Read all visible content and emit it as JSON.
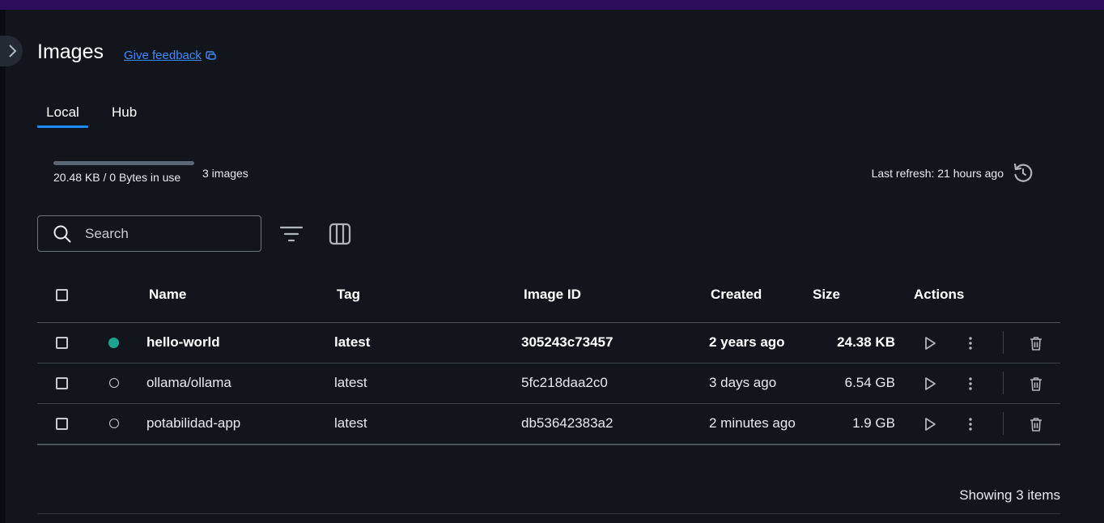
{
  "page": {
    "title": "Images",
    "feedback_label": "Give feedback",
    "tabs": [
      {
        "label": "Local",
        "active": true
      },
      {
        "label": "Hub",
        "active": false
      }
    ]
  },
  "usage": {
    "text": "20.48 KB / 0 Bytes in use",
    "count": "3 images",
    "fill_fraction": 1.0,
    "last_refresh": "Last refresh: 21 hours ago"
  },
  "search": {
    "placeholder": "Search",
    "value": ""
  },
  "table": {
    "headers": {
      "name": "Name",
      "tag": "Tag",
      "image_id": "Image ID",
      "created": "Created",
      "size": "Size",
      "actions": "Actions"
    },
    "rows": [
      {
        "name": "hello-world",
        "tag": "latest",
        "image_id": "305243c73457",
        "created": "2 years ago",
        "size": "24.38 KB",
        "in_use": true
      },
      {
        "name": "ollama/ollama",
        "tag": "latest",
        "image_id": "5fc218daa2c0",
        "created": "3 days ago",
        "size": "6.54 GB",
        "in_use": false
      },
      {
        "name": "potabilidad-app",
        "tag": "latest",
        "image_id": "db53642383a2",
        "created": "2 minutes ago",
        "size": "1.9 GB",
        "in_use": false
      }
    ]
  },
  "footer": {
    "showing": "Showing 3 items"
  },
  "colors": {
    "accent": "#1a8cff",
    "link": "#3b8cff",
    "in_use_dot": "#1aa58c",
    "background": "#12161c",
    "top_bar": "#2b0d5c"
  },
  "icons": {
    "expand": "chevron-right-icon",
    "feedback": "external-feedback-icon",
    "refresh": "refresh-icon",
    "search": "search-icon",
    "filter": "filter-icon",
    "columns": "columns-icon",
    "run": "play-icon",
    "more": "more-vertical-icon",
    "delete": "trash-icon"
  }
}
